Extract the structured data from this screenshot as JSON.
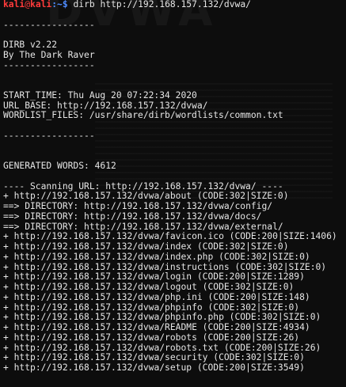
{
  "prompt": {
    "user": "kali",
    "at": "@",
    "host": "kali",
    "path": ":~",
    "symbol": "$",
    "command": "dirb http://192.168.157.132/dvwa/"
  },
  "separator": "-----------------",
  "banner": {
    "version": "DIRB v2.22",
    "author": "By The Dark Raver"
  },
  "info": {
    "start_time": "START_TIME: Thu Aug 20 07:22:34 2020",
    "url_base": "URL_BASE: http://192.168.157.132/dvwa/",
    "wordlist": "WORDLIST_FILES: /usr/share/dirb/wordlists/common.txt"
  },
  "generated_words": "GENERATED WORDS: 4612",
  "scanning": "---- Scanning URL: http://192.168.157.132/dvwa/ ----",
  "results": [
    {
      "marker": "+",
      "text": "http://192.168.157.132/dvwa/about (CODE:302|SIZE:0)"
    },
    {
      "marker": "==>",
      "text": "DIRECTORY: http://192.168.157.132/dvwa/config/"
    },
    {
      "marker": "==>",
      "text": "DIRECTORY: http://192.168.157.132/dvwa/docs/"
    },
    {
      "marker": "==>",
      "text": "DIRECTORY: http://192.168.157.132/dvwa/external/"
    },
    {
      "marker": "+",
      "text": "http://192.168.157.132/dvwa/favicon.ico (CODE:200|SIZE:1406)"
    },
    {
      "marker": "+",
      "text": "http://192.168.157.132/dvwa/index (CODE:302|SIZE:0)"
    },
    {
      "marker": "+",
      "text": "http://192.168.157.132/dvwa/index.php (CODE:302|SIZE:0)"
    },
    {
      "marker": "+",
      "text": "http://192.168.157.132/dvwa/instructions (CODE:302|SIZE:0)"
    },
    {
      "marker": "+",
      "text": "http://192.168.157.132/dvwa/login (CODE:200|SIZE:1289)"
    },
    {
      "marker": "+",
      "text": "http://192.168.157.132/dvwa/logout (CODE:302|SIZE:0)"
    },
    {
      "marker": "+",
      "text": "http://192.168.157.132/dvwa/php.ini (CODE:200|SIZE:148)"
    },
    {
      "marker": "+",
      "text": "http://192.168.157.132/dvwa/phpinfo (CODE:302|SIZE:0)"
    },
    {
      "marker": "+",
      "text": "http://192.168.157.132/dvwa/phpinfo.php (CODE:302|SIZE:0)"
    },
    {
      "marker": "+",
      "text": "http://192.168.157.132/dvwa/README (CODE:200|SIZE:4934)"
    },
    {
      "marker": "+",
      "text": "http://192.168.157.132/dvwa/robots (CODE:200|SIZE:26)"
    },
    {
      "marker": "+",
      "text": "http://192.168.157.132/dvwa/robots.txt (CODE:200|SIZE:26)"
    },
    {
      "marker": "+",
      "text": "http://192.168.157.132/dvwa/security (CODE:302|SIZE:0)"
    },
    {
      "marker": "+",
      "text": "http://192.168.157.132/dvwa/setup (CODE:200|SIZE:3549)"
    }
  ],
  "colors": {
    "background": "#0d0d0d",
    "text": "#e6e6e6",
    "prompt_user": "#ff3b3b",
    "prompt_path": "#4f8cff"
  }
}
